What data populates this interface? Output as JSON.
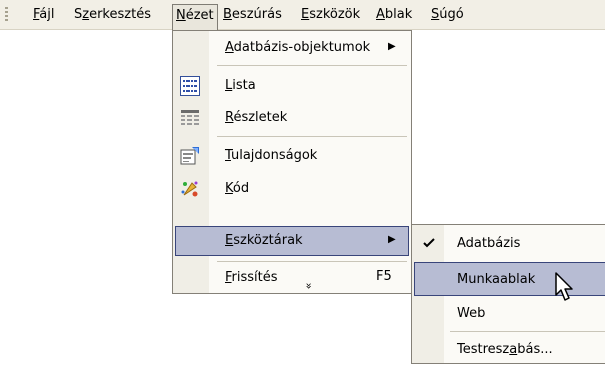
{
  "menubar": {
    "items": [
      {
        "id": "file",
        "pre": "",
        "key": "F",
        "post": "ájl"
      },
      {
        "id": "edit",
        "pre": "S",
        "key": "z",
        "post": "erkesztés"
      },
      {
        "id": "view",
        "pre": "",
        "key": "N",
        "post": "ézet"
      },
      {
        "id": "insert",
        "pre": "",
        "key": "B",
        "post": "eszúrás"
      },
      {
        "id": "tools",
        "pre": "",
        "key": "E",
        "post": "szközök"
      },
      {
        "id": "window",
        "pre": "",
        "key": "A",
        "post": "blak"
      },
      {
        "id": "help",
        "pre": "",
        "key": "S",
        "post": "úgó"
      }
    ]
  },
  "view_menu": {
    "items": [
      {
        "id": "database-objects",
        "pre": "",
        "key": "A",
        "post": "datbázis-objektumok",
        "icon": "",
        "has_submenu": true
      },
      {
        "id": "list",
        "pre": "",
        "key": "L",
        "post": "ista",
        "icon": "list-icon"
      },
      {
        "id": "details",
        "pre": "",
        "key": "R",
        "post": "észletek",
        "icon": "details-icon"
      },
      {
        "id": "properties",
        "pre": "",
        "key": "T",
        "post": "ulajdonságok",
        "icon": "properties-icon"
      },
      {
        "id": "code",
        "pre": "",
        "key": "K",
        "post": "ód",
        "icon": "code-icon"
      },
      {
        "id": "toolbars",
        "pre": "",
        "key": "E",
        "post": "szköztárak",
        "icon": "",
        "has_submenu": true,
        "highlighted": true
      },
      {
        "id": "refresh",
        "pre": "",
        "key": "F",
        "post": "rissítés",
        "shortcut": "F5"
      }
    ],
    "expand_glyph": "»"
  },
  "toolbars_submenu": {
    "items": [
      {
        "id": "database",
        "label": "Adatbázis",
        "checked": true
      },
      {
        "id": "task-pane",
        "label": "Munkaablak",
        "highlighted": true
      },
      {
        "id": "web",
        "label": "Web"
      },
      {
        "id": "customize",
        "pre": "Testresz",
        "key": "a",
        "post": "bás..."
      }
    ]
  },
  "colors": {
    "menubar_bg": "#f2efe6",
    "highlight_bg": "#b7bcd3",
    "highlight_border": "#39457a",
    "menu_bg": "#fbfaf6",
    "icon_column_bg": "#f0eee6"
  }
}
